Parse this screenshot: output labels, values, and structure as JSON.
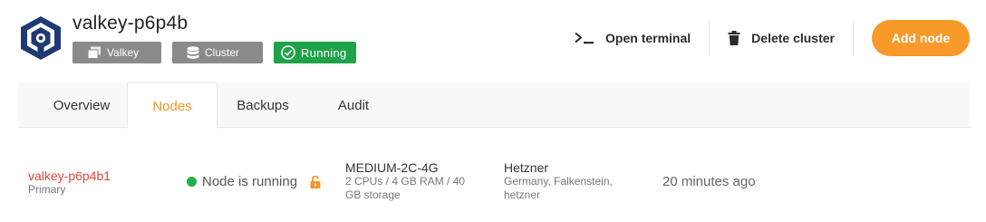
{
  "cluster": {
    "name": "valkey-p6p4b",
    "badges": {
      "engine": "Valkey",
      "type": "Cluster",
      "status": "Running"
    }
  },
  "actions": {
    "terminal": "Open terminal",
    "delete": "Delete cluster",
    "add": "Add node"
  },
  "tabs": [
    {
      "label": "Overview",
      "active": false
    },
    {
      "label": "Nodes",
      "active": true
    },
    {
      "label": "Backups",
      "active": false
    },
    {
      "label": "Audit",
      "active": false
    }
  ],
  "nodes": [
    {
      "name": "valkey-p6p4b1",
      "role": "Primary",
      "status": "Node is running",
      "plan": "MEDIUM-2C-4G",
      "plan_detail": "2 CPUs / 4 GB RAM / 40 GB storage",
      "provider": "Hetzner",
      "location": "Germany, Falkenstein, hetzner",
      "created": "20 minutes ago"
    }
  ],
  "colors": {
    "accent": "#f79a2a",
    "running": "#1ea34a",
    "node_name": "#e2443b",
    "badge_gray": "#8a8a8a"
  }
}
